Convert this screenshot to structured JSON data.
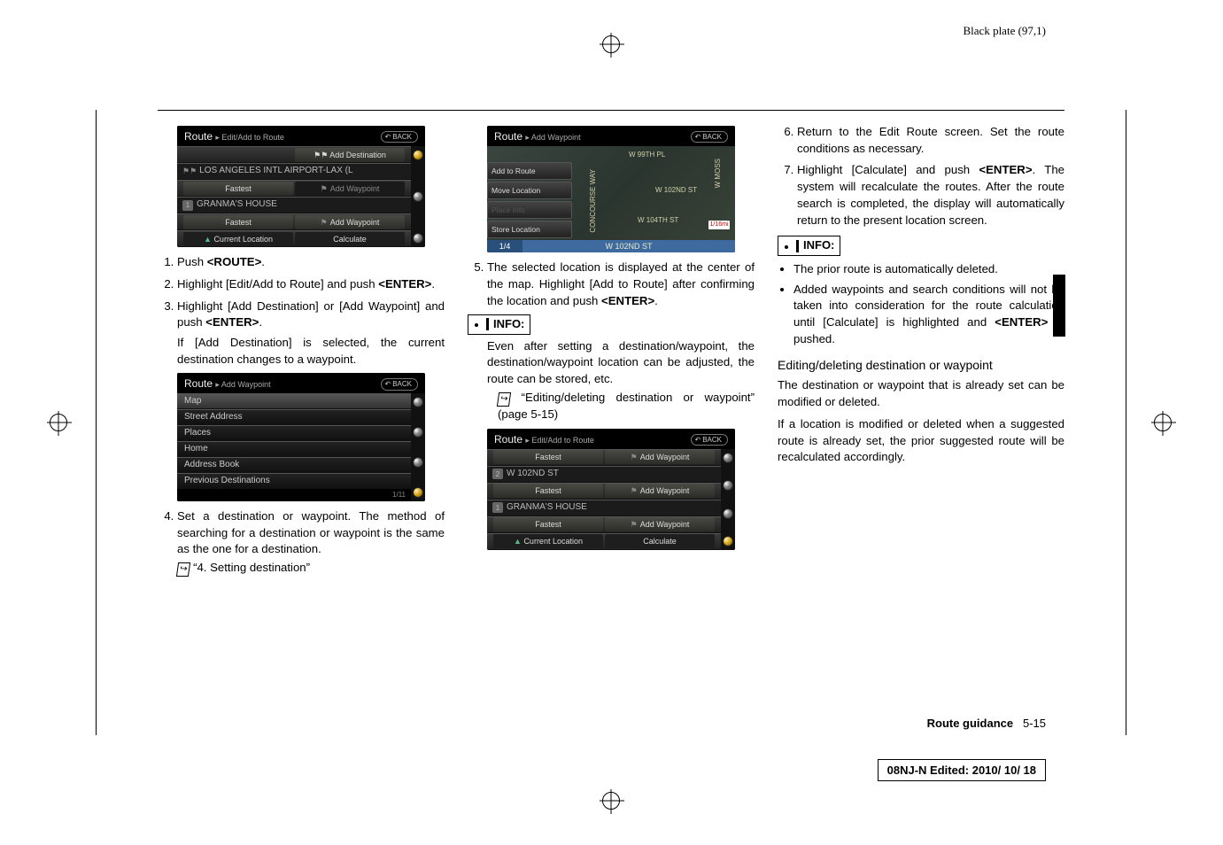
{
  "header": {
    "plate": "Black plate (97,1)"
  },
  "col1": {
    "ss1": {
      "breadcrumb_main": "Route",
      "breadcrumb_sub": "▸ Edit/Add to Route",
      "back": "BACK",
      "add_dest": "⚑⚑ Add Destination",
      "airport": "LOS ANGELES INTL AIRPORT-LAX (L",
      "fastest": "Fastest",
      "add_wp": "Add Waypoint",
      "granma": "GRANMA'S HOUSE",
      "curloc": "Current Location",
      "calc": "Calculate"
    },
    "step1": "Push <ROUTE>.",
    "step2": "Highlight [Edit/Add to Route] and push <ENTER>.",
    "step3": "Highlight [Add Destination] or [Add Waypoint] and push <ENTER>.",
    "step3_note": "If [Add Destination] is selected, the current destination changes to a waypoint.",
    "ss2": {
      "breadcrumb_main": "Route",
      "breadcrumb_sub": "▸ Add Waypoint",
      "back": "BACK",
      "items": [
        "Map",
        "Street Address",
        "Places",
        "Home",
        "Address Book",
        "Previous Destinations"
      ],
      "pager": "1/11"
    },
    "step4": "Set a destination or waypoint. The method of searching for a destination or waypoint is the same as the one for a destination.",
    "step4_ref": "“4. Setting destination”"
  },
  "col2": {
    "ss3": {
      "breadcrumb_main": "Route",
      "breadcrumb_sub": "▸ Add Waypoint",
      "back": "BACK",
      "panels": [
        "Add to Route",
        "Move Location",
        "Place Info",
        "Store Location"
      ],
      "streets": {
        "w99": "W 99TH PL",
        "w102": "W 102ND ST",
        "w104": "W 104TH ST",
        "w102b": "W 102ND ST",
        "cw": "CONCOURSE WAY",
        "moss": "W MOSS"
      },
      "indicator": "1/16mi",
      "pager": "1/4"
    },
    "step5": "The selected location is displayed at the center of the map. Highlight [Add to Route] after confirming the location and push <ENTER>.",
    "info_label": "INFO:",
    "info_text": "Even after setting a destination/waypoint, the destination/waypoint location can be adjusted, the route can be stored, etc.",
    "info_ref": "“Editing/deleting destination or waypoint” (page 5-15)",
    "ss4": {
      "breadcrumb_main": "Route",
      "breadcrumb_sub": "▸ Edit/Add to Route",
      "back": "BACK",
      "fastest": "Fastest",
      "add_wp": "Add Waypoint",
      "row2": "W 102ND ST",
      "granma": "GRANMA'S HOUSE",
      "curloc": "Current Location",
      "calc": "Calculate"
    }
  },
  "col3": {
    "step6": "Return to the Edit Route screen. Set the route conditions as necessary.",
    "step7": "Highlight [Calculate] and push <ENTER>. The system will recalculate the routes. After the route search is completed, the display will automatically return to the present location screen.",
    "info_label": "INFO:",
    "bullet1": "The prior route is automatically deleted.",
    "bullet2": "Added waypoints and search conditions will not be taken into consideration for the route calculation until [Calculate] is highlighted and <ENTER> is pushed.",
    "subhead": "Editing/deleting destination or waypoint",
    "para1": "The destination or waypoint that is already set can be modified or deleted.",
    "para2": "If a location is modified or deleted when a suggested route is already set, the prior suggested route will be recalculated accordingly."
  },
  "footer": {
    "section": "Route guidance",
    "page": "5-15",
    "edited": "08NJ-N Edited:  2010/ 10/ 18"
  }
}
